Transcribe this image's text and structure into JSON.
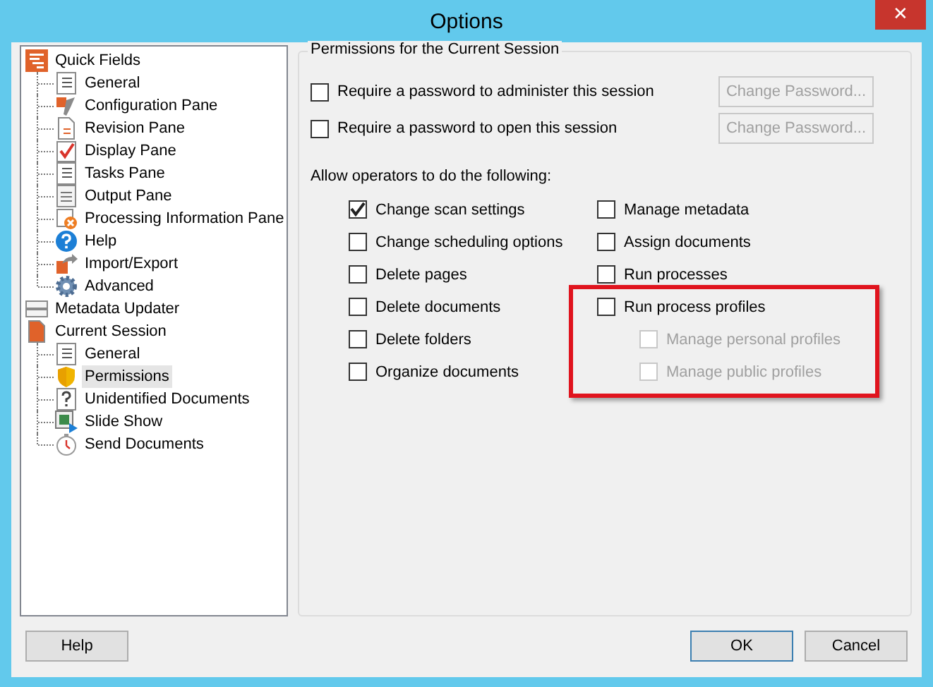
{
  "window": {
    "title": "Options",
    "close": "✕"
  },
  "tree": [
    {
      "label": "Quick Fields",
      "selected": false,
      "children": [
        {
          "label": "General",
          "selected": false
        },
        {
          "label": "Configuration Pane",
          "selected": false
        },
        {
          "label": "Revision Pane",
          "selected": false
        },
        {
          "label": "Display Pane",
          "selected": false
        },
        {
          "label": "Tasks Pane",
          "selected": false
        },
        {
          "label": "Output Pane",
          "selected": false
        },
        {
          "label": "Processing Information Pane",
          "selected": false
        },
        {
          "label": "Help",
          "selected": false
        },
        {
          "label": "Import/Export",
          "selected": false
        },
        {
          "label": "Advanced",
          "selected": false
        }
      ]
    },
    {
      "label": "Metadata Updater",
      "selected": false
    },
    {
      "label": "Current Session",
      "selected": false,
      "children": [
        {
          "label": "General",
          "selected": false
        },
        {
          "label": "Permissions",
          "selected": true
        },
        {
          "label": "Unidentified Documents",
          "selected": false
        },
        {
          "label": "Slide Show",
          "selected": false
        },
        {
          "label": "Send Documents",
          "selected": false
        }
      ]
    }
  ],
  "group": {
    "title": "Permissions for the Current Session",
    "passwords": [
      {
        "label": "Require a password to administer this session",
        "checked": false,
        "button": "Change Password...",
        "button_disabled": true
      },
      {
        "label": "Require a password to open this session",
        "checked": false,
        "button": "Change Password...",
        "button_disabled": true
      }
    ],
    "allow_label": "Allow operators to do the following:",
    "columns": [
      [
        {
          "label": "Change scan settings",
          "checked": true,
          "disabled": false
        },
        {
          "label": "Change scheduling options",
          "checked": false,
          "disabled": false
        },
        {
          "label": "Delete pages",
          "checked": false,
          "disabled": false
        },
        {
          "label": "Delete documents",
          "checked": false,
          "disabled": false
        },
        {
          "label": "Delete folders",
          "checked": false,
          "disabled": false
        },
        {
          "label": "Organize documents",
          "checked": false,
          "disabled": false
        }
      ],
      [
        {
          "label": "Manage metadata",
          "checked": false,
          "disabled": false
        },
        {
          "label": "Assign documents",
          "checked": false,
          "disabled": false
        },
        {
          "label": "Run processes",
          "checked": false,
          "disabled": false
        },
        {
          "label": "Run process profiles",
          "checked": false,
          "disabled": false,
          "highlighted": true,
          "children": [
            {
              "label": "Manage personal profiles",
              "checked": false,
              "disabled": true
            },
            {
              "label": "Manage public profiles",
              "checked": false,
              "disabled": true
            }
          ]
        }
      ]
    ]
  },
  "buttons": {
    "help": "Help",
    "ok": "OK",
    "cancel": "Cancel"
  }
}
